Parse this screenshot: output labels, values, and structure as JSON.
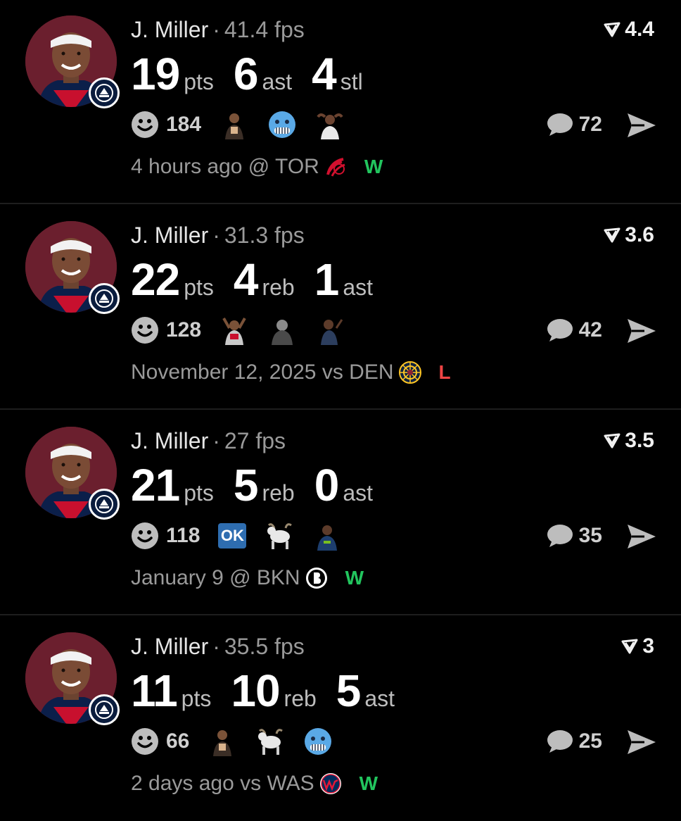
{
  "colors": {
    "background": "#000000",
    "avatar_bg": "#6b1f2e",
    "win": "#22c55e",
    "loss": "#ef4444",
    "muted": "#9a9a9a"
  },
  "posts": [
    {
      "player": "J. Miller",
      "fps": "41.4 fps",
      "rating": "4.4",
      "stats": [
        {
          "num": "19",
          "label": "pts"
        },
        {
          "num": "6",
          "label": "ast"
        },
        {
          "num": "4",
          "label": "stl"
        }
      ],
      "reaction_count": "184",
      "reaction_emojis": [
        "player-photo-reaction",
        "cold-face-emoji",
        "shocked-player-reaction"
      ],
      "comment_count": "72",
      "game_info": "4 hours ago @ TOR",
      "opponent_logo": "raptors-logo-icon",
      "result": "W"
    },
    {
      "player": "J. Miller",
      "fps": "31.3 fps",
      "rating": "3.6",
      "stats": [
        {
          "num": "22",
          "label": "pts"
        },
        {
          "num": "4",
          "label": "reb"
        },
        {
          "num": "1",
          "label": "ast"
        }
      ],
      "reaction_count": "128",
      "reaction_emojis": [
        "player-photo-reaction",
        "player-photo-reaction",
        "player-photo-reaction"
      ],
      "comment_count": "42",
      "game_info": "November 12, 2025 vs DEN",
      "opponent_logo": "nuggets-logo-icon",
      "result": "L"
    },
    {
      "player": "J. Miller",
      "fps": "27 fps",
      "rating": "3.5",
      "stats": [
        {
          "num": "21",
          "label": "pts"
        },
        {
          "num": "5",
          "label": "reb"
        },
        {
          "num": "0",
          "label": "ast"
        }
      ],
      "reaction_count": "118",
      "reaction_emojis": [
        "ok-button-emoji",
        "goat-emoji",
        "player-photo-reaction"
      ],
      "ok_label": "OK",
      "comment_count": "35",
      "game_info": "January 9 @ BKN",
      "opponent_logo": "nets-logo-icon",
      "result": "W"
    },
    {
      "player": "J. Miller",
      "fps": "35.5 fps",
      "rating": "3",
      "stats": [
        {
          "num": "11",
          "label": "pts"
        },
        {
          "num": "10",
          "label": "reb"
        },
        {
          "num": "5",
          "label": "ast"
        }
      ],
      "reaction_count": "66",
      "reaction_emojis": [
        "player-photo-reaction",
        "goat-emoji",
        "cold-face-emoji"
      ],
      "comment_count": "25",
      "game_info": "2 days ago vs WAS",
      "opponent_logo": "wizards-logo-icon",
      "result": "W"
    }
  ]
}
